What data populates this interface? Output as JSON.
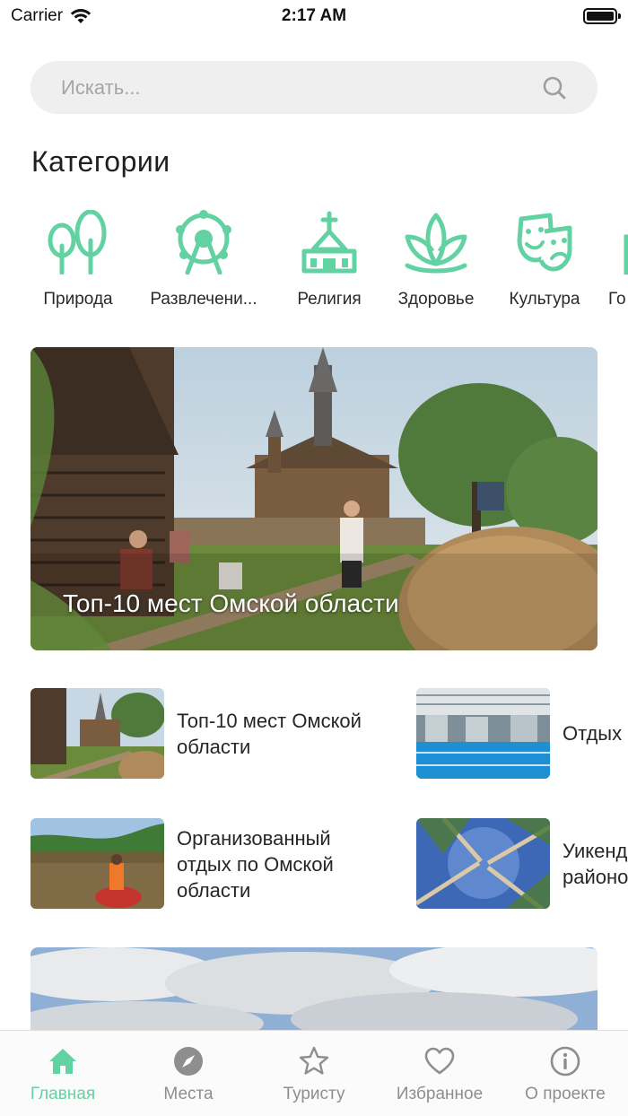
{
  "status_bar": {
    "carrier": "Carrier",
    "time": "2:17 AM"
  },
  "search": {
    "placeholder": "Искать..."
  },
  "categories": {
    "title": "Категории",
    "items": [
      {
        "label": "Природа",
        "icon": "trees-icon"
      },
      {
        "label": "Развлечени...",
        "icon": "ferris-wheel-icon"
      },
      {
        "label": "Религия",
        "icon": "church-icon"
      },
      {
        "label": "Здоровье",
        "icon": "lotus-icon"
      },
      {
        "label": "Культура",
        "icon": "theater-masks-icon"
      },
      {
        "label": "Го",
        "icon": "city-icon"
      }
    ]
  },
  "hero": {
    "title": "Топ-10 мест Омской области"
  },
  "articles": [
    {
      "title_line1": "Топ-10 мест Омской",
      "title_line2": "области",
      "title_line3": ""
    },
    {
      "title_line1": "Отдых",
      "title_line2": "",
      "title_line3": ""
    },
    {
      "title_line1": "Организованный",
      "title_line2": "отдых по Омской",
      "title_line3": "области"
    },
    {
      "title_line1": "Уикенд",
      "title_line2": "районо",
      "title_line3": ""
    }
  ],
  "tabbar": {
    "items": [
      {
        "label": "Главная",
        "icon": "home-icon",
        "active": true
      },
      {
        "label": "Места",
        "icon": "compass-icon"
      },
      {
        "label": "Туристу",
        "icon": "star-icon"
      },
      {
        "label": "Избранное",
        "icon": "heart-icon"
      },
      {
        "label": "О проекте",
        "icon": "info-icon"
      }
    ]
  },
  "colors": {
    "accent": "#62d2a2",
    "inactive": "#8e8e8e",
    "search_bg": "#efefef"
  }
}
